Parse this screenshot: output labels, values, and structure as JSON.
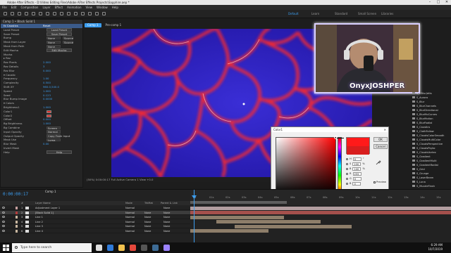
{
  "title_bar": {
    "title": "Adobe After Effects - D:\\Video Editing Files\\Adobe AFter Effects Projects\\Sapphire.aep *"
  },
  "menu": [
    "File",
    "Edit",
    "Composition",
    "Layer",
    "Effect",
    "Animation",
    "View",
    "Window",
    "Help"
  ],
  "workspaces": [
    {
      "label": "Default",
      "active": true
    },
    {
      "label": "Learn",
      "active": false
    },
    {
      "label": "Standard",
      "active": false
    },
    {
      "label": "Small Screen",
      "active": false
    },
    {
      "label": "Libraries",
      "active": false
    }
  ],
  "effect_controls": {
    "tab_label": "Comp 1 • Black Solid 1",
    "rows": [
      {
        "label": "fx Caustics",
        "value": "Reset",
        "kind": "hl"
      },
      {
        "label": "Load Preset",
        "value": "Load Preset",
        "kind": "btn"
      },
      {
        "label": "Save Preset",
        "value": "Save Preset",
        "kind": "btn"
      },
      {
        "label": "Bump",
        "value": "None",
        "value2": "Source",
        "kind": "dd"
      },
      {
        "label": "Mask from Layer",
        "value": "None",
        "value2": "Source",
        "kind": "dd"
      },
      {
        "label": "Mask from Path",
        "value": "None",
        "kind": "dd"
      },
      {
        "label": "Edit Mocha",
        "value": "Edit Mocha",
        "kind": "btn"
      },
      {
        "label": "Mocha",
        "value": "",
        "kind": "text"
      },
      {
        "label": "▸ Rez",
        "value": "",
        "kind": "text"
      },
      {
        "label": "Rez Pixels",
        "value": "2.000",
        "kind": "num"
      },
      {
        "label": "Rez Details",
        "value": "3",
        "kind": "num"
      },
      {
        "label": "Rez Blur",
        "value": "0.000",
        "kind": "num"
      },
      {
        "label": "▾ Caustic",
        "value": "",
        "kind": "text"
      },
      {
        "label": "Frequency",
        "value": "1.00",
        "kind": "num"
      },
      {
        "label": "Complexity",
        "value": "0.500",
        "kind": "num"
      },
      {
        "label": "Shift XY",
        "value": "960.0,540.0",
        "kind": "num"
      },
      {
        "label": "Speed",
        "value": "1.000",
        "kind": "num"
      },
      {
        "label": "Seed",
        "value": "0.123",
        "kind": "num"
      },
      {
        "label": "Blur Bump Image",
        "value": "0.0000",
        "kind": "num"
      },
      {
        "label": "▾ Colors",
        "value": "",
        "kind": "text"
      },
      {
        "label": "Brightness1",
        "value": "1.000",
        "kind": "num"
      },
      {
        "label": "Color1",
        "value": "",
        "kind": "swatch"
      },
      {
        "label": "Color2",
        "value": "",
        "kind": "swatch"
      },
      {
        "label": "Offset",
        "value": "0.000",
        "kind": "num"
      },
      {
        "label": "Bg Brightness",
        "value": "1.000",
        "kind": "num"
      },
      {
        "label": "Bg Combine",
        "value": "Screen",
        "kind": "dd"
      },
      {
        "label": "Input Opacity",
        "value": "Normal",
        "kind": "dd"
      },
      {
        "label": "Output Opacity",
        "value": "Copy From Input",
        "kind": "dd"
      },
      {
        "label": "Mask Use",
        "value": "Luma",
        "kind": "dd"
      },
      {
        "label": "Blur Mask",
        "value": "0.00",
        "kind": "num"
      },
      {
        "label": "Invert Mask",
        "value": "",
        "kind": "text"
      },
      {
        "label": "Help",
        "value": "Help",
        "kind": "btn"
      }
    ]
  },
  "viewer": {
    "tabs": [
      {
        "label": "Comp 1",
        "active": true
      },
      {
        "label": "Pre-comp 1",
        "active": false
      }
    ],
    "bottom_bar": "(50%)   0:00:00:17   Full   Active Camera   1 View   +0.0"
  },
  "webcam": {
    "overlay_text": "OnyxJOSHPER"
  },
  "project_panel": {
    "items": [
      "S_ZBlurJetts",
      "S_Aurora",
      "S_Blur",
      "S_BlurChannels",
      "S_BlurDirectional",
      "S_BlurMoCurves",
      "S_BlurMotion",
      "S_BlurRadial",
      "S_Caustics",
      "S_ClothFollow",
      "S_CloudsColorSmooth",
      "S_CloudsMultiColor",
      "S_CloudsPerspective",
      "S_CloudsPsyko",
      "S_CloudsVortex",
      "S_Gradient",
      "S_GradientMulti",
      "S_GradientRadial",
      "S_Grid",
      "S_Grunge",
      "S_LaserBeam",
      "S_Luna",
      "S_MuzzleFlash",
      "S_NightSky",
      "S_Shape",
      "S_Sparkles",
      "S_TextureCells",
      "S_TextureChromaSpiral",
      "S_TextureFolded",
      "S_TextureFlow",
      "S_TextureLoops",
      "S_TextureMicro",
      "S_TextureNoise"
    ]
  },
  "color_picker": {
    "title": "Color1",
    "ok_label": "OK",
    "cancel_label": "Cancel",
    "fields": [
      {
        "label": "H",
        "value": "0",
        "unit": "°"
      },
      {
        "label": "S",
        "value": "100",
        "unit": "%"
      },
      {
        "label": "B",
        "value": "100",
        "unit": "%"
      },
      {
        "label": "R",
        "value": "255",
        "unit": ""
      },
      {
        "label": "G",
        "value": "0",
        "unit": ""
      },
      {
        "label": "B",
        "value": "0",
        "unit": ""
      }
    ],
    "preview_label": "Preview",
    "hex_prefix": "#",
    "hex_value": "FF0000",
    "new_color": "#ff1a1a",
    "current_color": "#d81e1e"
  },
  "timeline": {
    "tab_label": "Comp 1",
    "timecode": "0:00:00:17",
    "headers": {
      "num": "#",
      "source": "Layer Name",
      "mode": "Mode",
      "trkmat": "TrkMat",
      "parent": "Parent & Link"
    },
    "layers": [
      {
        "num": "1",
        "name": "Adjustment Layer 1",
        "tag": "#c8a0a0",
        "mode": "Normal",
        "trkmat": "",
        "parent": "None",
        "selected": false
      },
      {
        "num": "2",
        "name": "[Black Solid 1]",
        "tag": "#b43c3c",
        "mode": "Normal",
        "trkmat": "None",
        "parent": "None",
        "selected": true
      },
      {
        "num": "3",
        "name": "Line 1",
        "tag": "#c9b7a0",
        "mode": "Normal",
        "trkmat": "None",
        "parent": "None",
        "selected": false
      },
      {
        "num": "4",
        "name": "Line 2",
        "tag": "#c9b7a0",
        "mode": "Normal",
        "trkmat": "None",
        "parent": "None",
        "selected": false
      },
      {
        "num": "5",
        "name": "Line 3",
        "tag": "#c9b7a0",
        "mode": "Normal",
        "trkmat": "None",
        "parent": "None",
        "selected": false
      },
      {
        "num": "6",
        "name": "Line 4",
        "tag": "#c9b7a0",
        "mode": "Normal",
        "trkmat": "None",
        "parent": "None",
        "selected": false
      }
    ],
    "ruler_ticks": [
      "0s",
      "01s",
      "02s",
      "03s",
      "04s",
      "05s",
      "06s",
      "07s",
      "08s",
      "09s",
      "10s",
      "11s",
      "12s",
      "13s",
      "14s",
      "15s"
    ],
    "bars": [
      {
        "start": 0.0,
        "end": 1.0,
        "color": "#b39ea0"
      },
      {
        "start": 0.0,
        "end": 1.0,
        "color": "#a5504c"
      },
      {
        "start": 0.0,
        "end": 0.36,
        "color": "#8e7e6a"
      },
      {
        "start": 0.1,
        "end": 0.5,
        "color": "#8e7e6a"
      },
      {
        "start": 0.17,
        "end": 0.62,
        "color": "#8e7e6a"
      },
      {
        "start": 0.0,
        "end": 0.3,
        "color": "#8e7e6a"
      }
    ]
  },
  "taskbar": {
    "search_placeholder": "Type here to search",
    "time": "6:29 AM",
    "date": "10/7/2019",
    "icons": [
      {
        "name": "task-view-icon",
        "color": "#dddddd"
      },
      {
        "name": "edge-icon",
        "color": "#2f7ad8"
      },
      {
        "name": "explorer-icon",
        "color": "#f2c14e"
      },
      {
        "name": "chrome-icon",
        "color": "#e5483c"
      },
      {
        "name": "obs-icon",
        "color": "#555555"
      },
      {
        "name": "steam-icon",
        "color": "#3d6b95"
      },
      {
        "name": "after-effects-icon",
        "color": "#9b82ff"
      }
    ]
  }
}
